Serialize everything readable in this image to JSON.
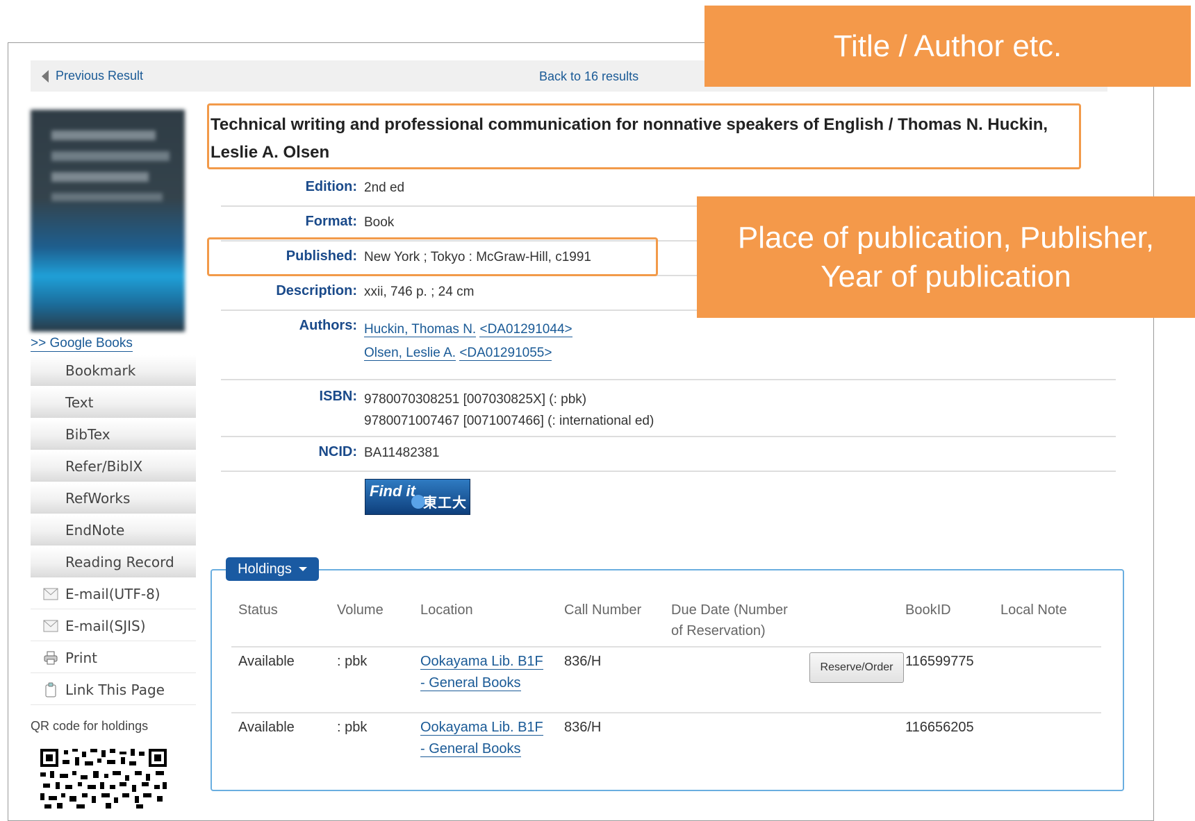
{
  "nav": {
    "previous": "Previous Result",
    "back": "Back to 16 results"
  },
  "google_books": ">> Google Books",
  "sidebar": {
    "items": [
      {
        "label": "Bookmark",
        "icon": ""
      },
      {
        "label": "Text",
        "icon": ""
      },
      {
        "label": "BibTex",
        "icon": ""
      },
      {
        "label": "Refer/BibIX",
        "icon": ""
      },
      {
        "label": "RefWorks",
        "icon": ""
      },
      {
        "label": "EndNote",
        "icon": ""
      },
      {
        "label": "Reading Record",
        "icon": ""
      },
      {
        "label": "E-mail(UTF-8)",
        "icon": "mail-icon"
      },
      {
        "label": "E-mail(SJIS)",
        "icon": "mail-icon"
      },
      {
        "label": "Print",
        "icon": "printer-icon"
      },
      {
        "label": "Link This Page",
        "icon": "clipboard-icon"
      }
    ],
    "qr_label": "QR code for holdings"
  },
  "record": {
    "title": "Technical writing and professional communication for nonnative speakers of English / Thomas N. Huckin, Leslie A. Olsen",
    "fields": {
      "edition": {
        "label": "Edition:",
        "value": "2nd ed"
      },
      "format": {
        "label": "Format:",
        "value": "Book"
      },
      "published": {
        "label": "Published:",
        "value": "New York ; Tokyo : McGraw-Hill, c1991"
      },
      "description": {
        "label": "Description:",
        "value": "xxii, 746 p. ; 24 cm"
      },
      "authors": {
        "label": "Authors:",
        "a1_name": "Huckin, Thomas N.",
        "a1_id": "<DA01291044>",
        "a2_name": "Olsen, Leslie A.",
        "a2_id": "<DA01291055>"
      },
      "isbn": {
        "label": "ISBN:",
        "line1": "9780070308251 [007030825X] (: pbk)",
        "line2": "9780071007467 [0071007466] (: international ed)"
      },
      "ncid": {
        "label": "NCID:",
        "value": "BA11482381"
      }
    },
    "findit": {
      "text": "Find it",
      "jp": "東工大"
    }
  },
  "holdings": {
    "tab_label": "Holdings",
    "headers": {
      "status": "Status",
      "volume": "Volume",
      "location": "Location",
      "call": "Call Number",
      "due1": "Due Date (Number",
      "due2": "of Reservation)",
      "bookid": "BookID",
      "note": "Local Note"
    },
    "rows": [
      {
        "status": "Available",
        "volume": ": pbk",
        "loc1": "Ookayama Lib. B1F",
        "loc2": "- General Books",
        "call": "836/H",
        "bookid": "116599775",
        "button": "Reserve/Order"
      },
      {
        "status": "Available",
        "volume": ": pbk",
        "loc1": "Ookayama Lib. B1F",
        "loc2": "- General Books",
        "call": "836/H",
        "bookid": "116656205"
      }
    ]
  },
  "callouts": {
    "title": "Title / Author etc.",
    "publication_l1": "Place of publication, Publisher,",
    "publication_l2": "Year of publication"
  },
  "colors": {
    "callout": "#f4994a",
    "link": "#1a5a96",
    "label": "#1a4a8a",
    "holdings_tab": "#1a5aa2"
  }
}
